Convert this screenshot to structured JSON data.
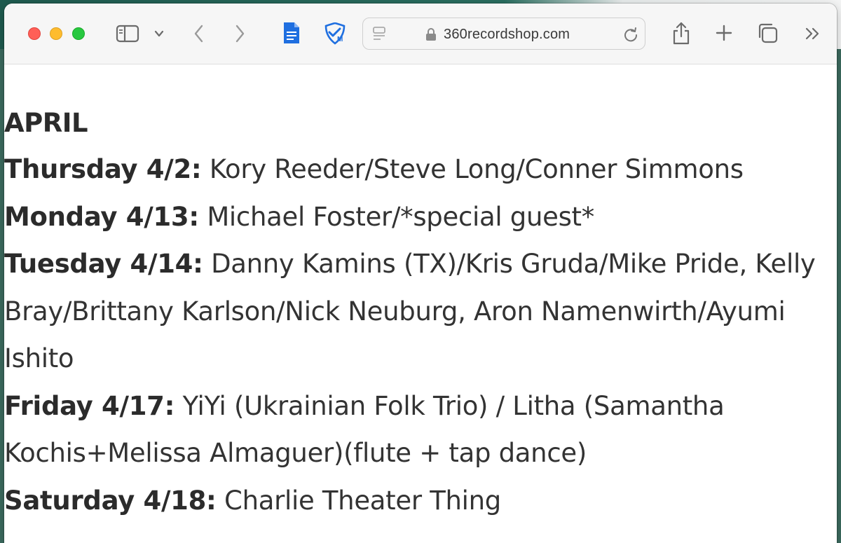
{
  "browser": {
    "url": "360recordshop.com",
    "icons": [
      "sidebar-icon",
      "chevron-down-icon",
      "back-icon",
      "forward-icon",
      "document-icon",
      "shield-m-icon",
      "reader-icon",
      "lock-icon",
      "reload-icon",
      "share-icon",
      "plus-icon",
      "tabs-icon",
      "more-icon"
    ]
  },
  "page": {
    "month": "APRIL",
    "events": [
      {
        "day": "Thursday 4/2:",
        "acts": "Kory Reeder/Steve Long/Conner Simmons"
      },
      {
        "day": "Monday 4/13:",
        "acts": "Michael Foster/*special guest*"
      },
      {
        "day": "Tuesday 4/14:",
        "acts": "Danny Kamins (TX)/Kris Gruda/Mike Pride, Kelly Bray/Brittany Karlson/Nick Neuburg, Aron Namenwirth/Ayumi Ishito"
      },
      {
        "day": "Friday 4/17:",
        "acts": "YiYi (Ukrainian Folk Trio) / Litha (Samantha Kochis+Melissa Almaguer)(flute + tap dance)"
      },
      {
        "day": "Saturday 4/18:",
        "acts": "Charlie Theater Thing"
      }
    ]
  }
}
